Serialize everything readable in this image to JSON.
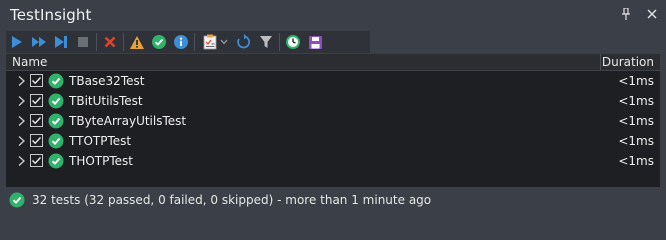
{
  "window": {
    "title": "TestInsight",
    "pin_glyph": "⇣",
    "close_glyph": "✕"
  },
  "toolbar": {
    "buttons": [
      {
        "icon": "run-icon"
      },
      {
        "icon": "run-all-icon"
      },
      {
        "icon": "step-icon"
      },
      {
        "icon": "stop-icon"
      },
      {
        "icon": "clear-icon"
      },
      {
        "icon": "warning-icon"
      },
      {
        "icon": "passed-icon"
      },
      {
        "icon": "info-icon"
      },
      {
        "icon": "checklist-icon"
      },
      {
        "icon": "refresh-icon"
      },
      {
        "icon": "filter-icon"
      },
      {
        "icon": "history-icon"
      },
      {
        "icon": "save-icon"
      }
    ]
  },
  "grid": {
    "columns": {
      "name": "Name",
      "duration": "Duration"
    },
    "rows": [
      {
        "name": "TBase32Test",
        "duration": "<1ms",
        "checked": true,
        "status": "passed"
      },
      {
        "name": "TBitUtilsTest",
        "duration": "<1ms",
        "checked": true,
        "status": "passed"
      },
      {
        "name": "TByteArrayUtilsTest",
        "duration": "<1ms",
        "checked": true,
        "status": "passed"
      },
      {
        "name": "TTOTPTest",
        "duration": "<1ms",
        "checked": true,
        "status": "passed"
      },
      {
        "name": "THOTPTest",
        "duration": "<1ms",
        "checked": true,
        "status": "passed"
      }
    ]
  },
  "status": {
    "text": "32 tests (32 passed, 0 failed, 0 skipped) - more than 1 minute ago"
  },
  "colors": {
    "accent_blue": "#3c8fd6",
    "passed_green": "#2fb36a",
    "clear_red": "#e0442b",
    "warning_orange": "#e8a23a",
    "save_purple": "#8b4fc4"
  }
}
